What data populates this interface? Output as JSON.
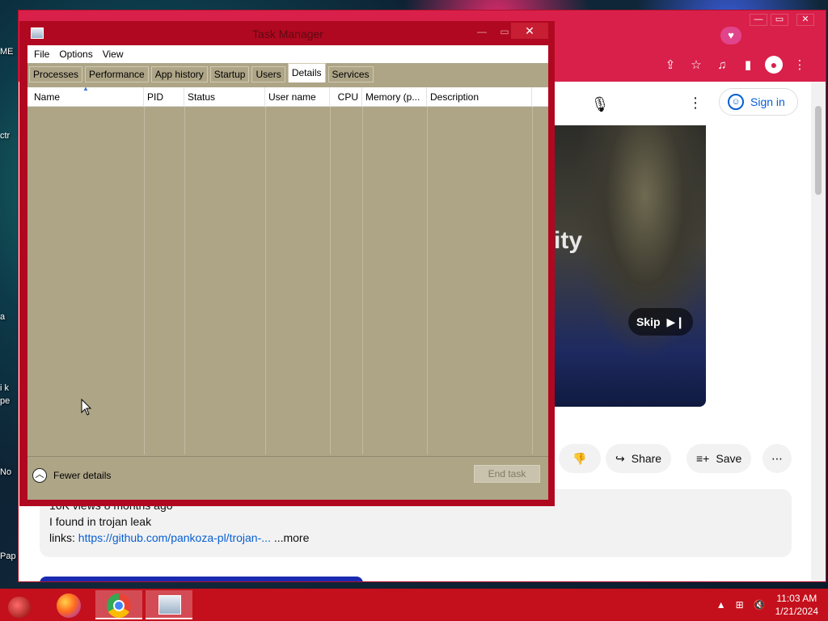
{
  "desktop": {
    "labels": [
      "ME",
      "ctr",
      "a",
      "i k",
      "pe",
      "No",
      "Pap"
    ]
  },
  "chrome": {
    "caption": {
      "minimize": "—",
      "maximize": "▭",
      "close": "✕"
    },
    "profile_icon": "heart-icon",
    "toolbar_icons": [
      "share-icon",
      "bookmark-star-icon",
      "media-controls-icon",
      "side-panel-icon",
      "avatar-icon",
      "menu-kebab-icon"
    ],
    "sign_in_label": "Sign in",
    "video_overlay_text": "ity",
    "skip_label": "Skip",
    "actions": {
      "share_label": "Share",
      "save_label": "Save"
    },
    "description": {
      "meta": "16K views  8 months ago",
      "line1": "I found in trojan leak",
      "links_prefix": "links: ",
      "link_text": "https://github.com/pankoza-pl/trojan-...",
      "more_label": "...more"
    }
  },
  "task_manager": {
    "title": "Task Manager",
    "menu": [
      "File",
      "Options",
      "View"
    ],
    "tabs": [
      "Processes",
      "Performance",
      "App history",
      "Startup",
      "Users",
      "Details",
      "Services"
    ],
    "active_tab": "Details",
    "columns": [
      "Name",
      "PID",
      "Status",
      "User name",
      "CPU",
      "Memory (p...",
      "Description"
    ],
    "rows": [],
    "fewer_details_label": "Fewer details",
    "end_task_label": "End task",
    "colors": {
      "accent": "#b00820",
      "body": "#aea587"
    }
  },
  "taskbar": {
    "apps": [
      "start-icon",
      "firefox-icon",
      "chrome-icon",
      "task-manager-icon"
    ],
    "clock_time": "11:03 AM",
    "clock_date": "1/21/2024"
  }
}
